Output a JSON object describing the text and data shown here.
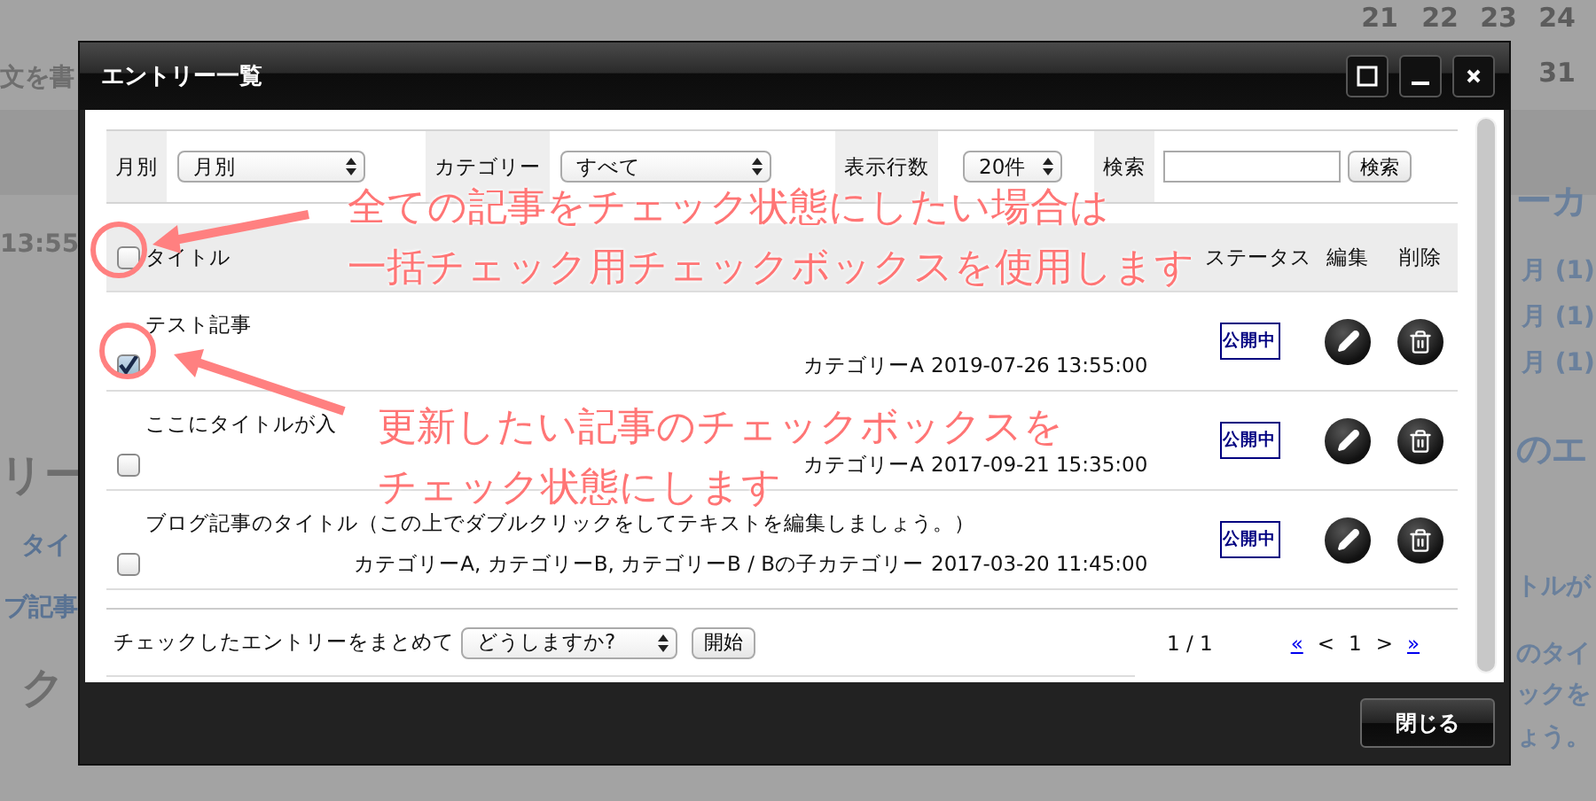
{
  "background_page": {
    "left_texts": [
      "文を書",
      "13:55",
      "リー",
      "タイ",
      "ブ記事",
      "ク"
    ],
    "calendar_numbers": [
      "21",
      "22",
      "23",
      "24",
      "31"
    ],
    "right_texts": [
      "ーカ",
      "月 (1)",
      "月 (1)",
      "月 (1)",
      "のエ",
      "トルが",
      "のタイ",
      "ックを",
      "ょう。"
    ]
  },
  "dialog": {
    "title": "エントリー一覧",
    "filters": {
      "month_label": "月別",
      "month_value": "月別",
      "category_label": "カテゴリー",
      "category_value": "すべて",
      "rows_label": "表示行数",
      "rows_value": "20件",
      "search_label": "検索",
      "search_button": "検索"
    },
    "select_all": {
      "checked": false
    },
    "columns": {
      "title": "タイトル",
      "status": "ステータス",
      "edit": "編集",
      "delete": "削除"
    },
    "rows": [
      {
        "title": "テスト記事",
        "category": "カテゴリーA",
        "date": "2019-07-26 13:55:00",
        "status": "公開中",
        "checked": true
      },
      {
        "title": "ここにタイトルが入",
        "category": "カテゴリーA",
        "date": "2017-09-21 15:35:00",
        "status": "公開中",
        "checked": false
      },
      {
        "title": "ブログ記事のタイトル（この上でダブルクリックをしてテキストを編集しましょう。）",
        "category": "カテゴリーA, カテゴリーB, カテゴリーB / Bの子カテゴリー",
        "date": "2017-03-20 11:45:00",
        "status": "公開中",
        "checked": false
      }
    ],
    "bulk": {
      "label": "チェックしたエントリーをまとめて",
      "action_value": "どうしますか?",
      "start_button": "開始"
    },
    "page_info": "1 / 1",
    "pager": [
      {
        "text": "«",
        "kind": "link"
      },
      {
        "text": "<",
        "kind": "plain"
      },
      {
        "text": "1",
        "kind": "plain"
      },
      {
        "text": ">",
        "kind": "plain"
      },
      {
        "text": "»",
        "kind": "link"
      }
    ],
    "close_button": "閉じる"
  },
  "annotations": [
    {
      "lines": [
        "全ての記事をチェック状態にしたい場合は",
        "一括チェック用チェックボックスを使用します"
      ]
    },
    {
      "lines": [
        "更新したい記事のチェックボックスを",
        "チェック状態にします"
      ]
    }
  ]
}
